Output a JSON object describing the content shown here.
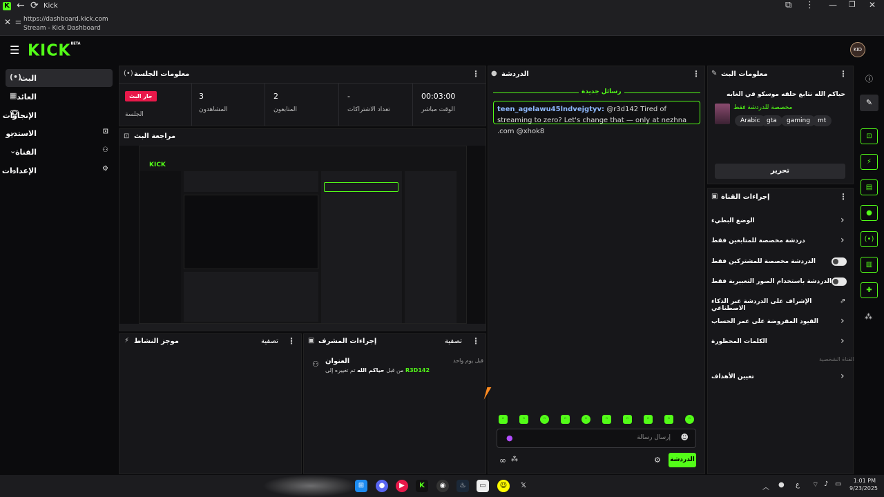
{
  "browser": {
    "tab_title": "Kick",
    "url": "https://dashboard.kick.com",
    "page_title": "Stream - Kick Dashboard"
  },
  "app": {
    "logo": "KICK",
    "logo_badge": "BETA",
    "avatar_initials": "KID"
  },
  "sidebar": {
    "items": [
      {
        "label": "البث",
        "icon": "broadcast-icon",
        "active": true
      },
      {
        "label": "العائد",
        "icon": "revenue-icon",
        "active": false
      },
      {
        "label": "الإنجازات",
        "icon": "trophy-icon",
        "active": false
      },
      {
        "label": "الاستديو",
        "icon": "chevron-down-icon",
        "active": false
      },
      {
        "label": "القناة",
        "icon": "chevron-down-icon",
        "active": false
      },
      {
        "label": "الإعدادات",
        "icon": "chevron-down-icon",
        "active": false
      }
    ]
  },
  "session": {
    "title": "معلومات الجلسة",
    "live_badge": "جار البث",
    "live_label": "الجلسة",
    "stats": [
      {
        "value": "3",
        "label": "المشاهدون"
      },
      {
        "value": "2",
        "label": "المتابعون"
      },
      {
        "value": "-",
        "label": "تعداد الاشتراكات"
      },
      {
        "value": "00:03:00",
        "label": "الوقت مباشر"
      }
    ]
  },
  "preview": {
    "title": "مراجعة البث"
  },
  "activity": {
    "title": "موجز النشاط",
    "filter": "تصفية"
  },
  "mod_actions": {
    "title": "إجراءات المشرف",
    "filter": "تصفية",
    "entry_title": "العنوان",
    "entry_time": "قبل يوم واحد",
    "entry_user": "R3D142",
    "entry_text": "تم تغييره إلى",
    "entry_value": "حياكم الله",
    "entry_suffix": "من قبل"
  },
  "chat": {
    "title": "الدردشة",
    "new_messages": "رسائل جديدة",
    "message_user": "teen_agelawu45lndvejgtyv:",
    "message_text": " @r3d142 Tired of streaming to zero? Let's change that — only at nezhna .com @xhok8",
    "input_placeholder": "إرسال رسالة",
    "send_label": "الدردشة"
  },
  "stream_info": {
    "title": "معلومات البث",
    "stream_title": "حياكم الله نتابع حلقه موسكو في الغابه",
    "subtitle": "مخصصة للدردشة فقط",
    "tags": [
      "Arabic",
      "gta",
      "gaming",
      "mt"
    ],
    "edit_label": "تحرير"
  },
  "channel_actions": {
    "title": "إجراءات القناة",
    "options": [
      {
        "label": "الوضع البطيء",
        "control": "chevron"
      },
      {
        "label": "دردشة مخصصة للمتابعين فقط",
        "control": "chevron"
      },
      {
        "label": "الدردشة مخصصة للمشتركين فقط",
        "control": "toggle"
      },
      {
        "label": "الدردشة باستخدام الصور التعبيرية فقط",
        "control": "toggle"
      },
      {
        "label": "الإشراف على الدردشة عبر الذكاء الاصطناعي",
        "control": "external"
      },
      {
        "label": "القيود المفروضة على عمر الحساب",
        "control": "chevron"
      },
      {
        "label": "الكلمات المحظورة",
        "control": "chevron"
      }
    ],
    "section_label": "القناة الشخصية",
    "goals_label": "تعيين الأهداف"
  },
  "taskbar": {
    "time": "1:01 PM",
    "date": "9/23/2025",
    "lang": "ع"
  },
  "colors": {
    "accent": "#53fc18",
    "live": "#e8194a",
    "panel": "#17171a"
  }
}
